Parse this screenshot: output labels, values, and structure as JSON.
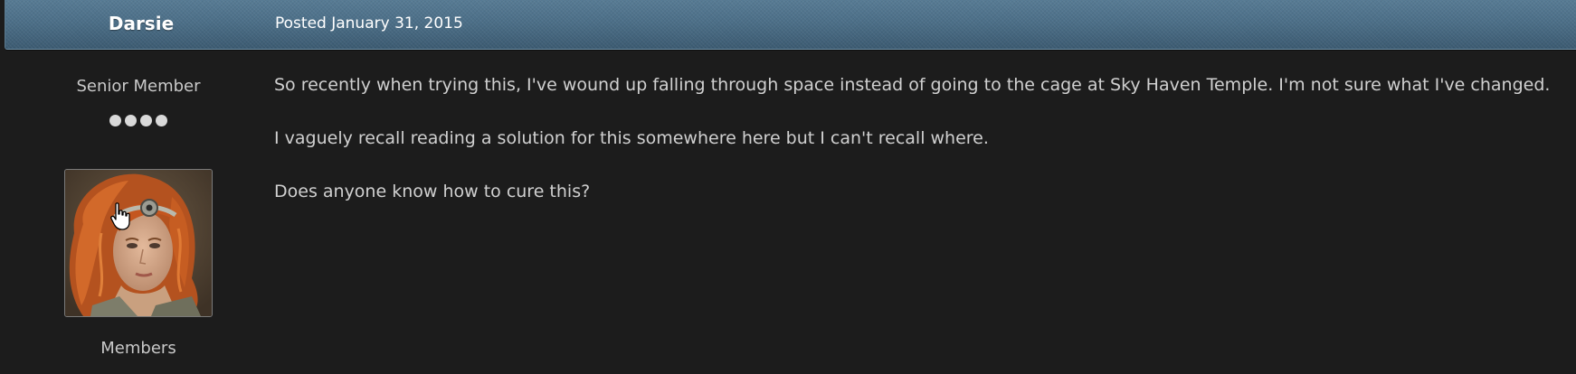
{
  "post": {
    "author": {
      "name": "Darsie",
      "title": "Senior Member",
      "rank_pips": 4,
      "group": "Members"
    },
    "date": "Posted January 31, 2015",
    "paragraphs": [
      "So recently when trying this, I've wound up falling through space instead of going to the cage at Sky Haven Temple. I'm not sure what I've changed.",
      "I vaguely recall reading a solution for this somewhere here but I can't recall where.",
      "Does anyone know how to cure this?"
    ]
  },
  "colors": {
    "page_background": "#1c1c1c",
    "header_blue": "#4c6f88",
    "body_text": "#d0d0d0",
    "meta_text": "#c9c9c9"
  },
  "icons": {
    "cursor": "hand-pointer-icon",
    "rank": "rank-pip-icon"
  }
}
